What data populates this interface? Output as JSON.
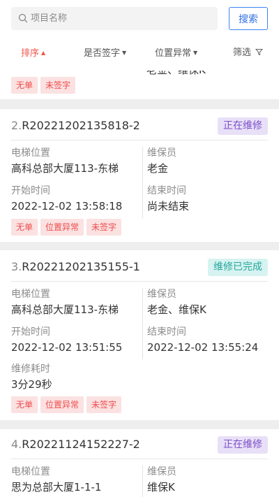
{
  "search": {
    "placeholder": "项目名称",
    "button": "搜索"
  },
  "filters": {
    "sort": "排序",
    "signed": "是否签字",
    "location": "位置异常",
    "more": "筛选"
  },
  "labels": {
    "elevator_location": "电梯位置",
    "maintainer": "维保员",
    "start_time": "开始时间",
    "end_time": "结束时间",
    "duration": "维修耗时"
  },
  "colors": {
    "accent": "#2f6fe4",
    "sort_active": "#f0554b",
    "tag_text": "#ef4c4c",
    "tag_bg": "#fbe1e1",
    "repairing": "#7c4fc9",
    "done": "#27a79c"
  },
  "records": [
    {
      "partial_text": "老金、维保K",
      "tags": [
        "无单",
        "未签字"
      ]
    },
    {
      "index": "2.",
      "order_no": "R20221202135818-2",
      "status": "正在维修",
      "elevator_location": "高科总部大厦113-东梯",
      "maintainer": "老金",
      "start_time": "2022-12-02 13:58:18",
      "end_time": "尚未结束",
      "tags": [
        "无单",
        "位置异常",
        "未签字"
      ]
    },
    {
      "index": "3.",
      "order_no": "R20221202135155-1",
      "status": "维修已完成",
      "elevator_location": "高科总部大厦113-东梯",
      "maintainer": "老金、维保K",
      "start_time": "2022-12-02 13:51:55",
      "end_time": "2022-12-02 13:55:24",
      "duration": "3分29秒",
      "tags": [
        "无单",
        "位置异常",
        "未签字"
      ]
    },
    {
      "index": "4.",
      "order_no": "R20221124152227-2",
      "status": "正在维修",
      "elevator_location": "思为总部大厦1-1-1",
      "maintainer": "维保K"
    }
  ]
}
